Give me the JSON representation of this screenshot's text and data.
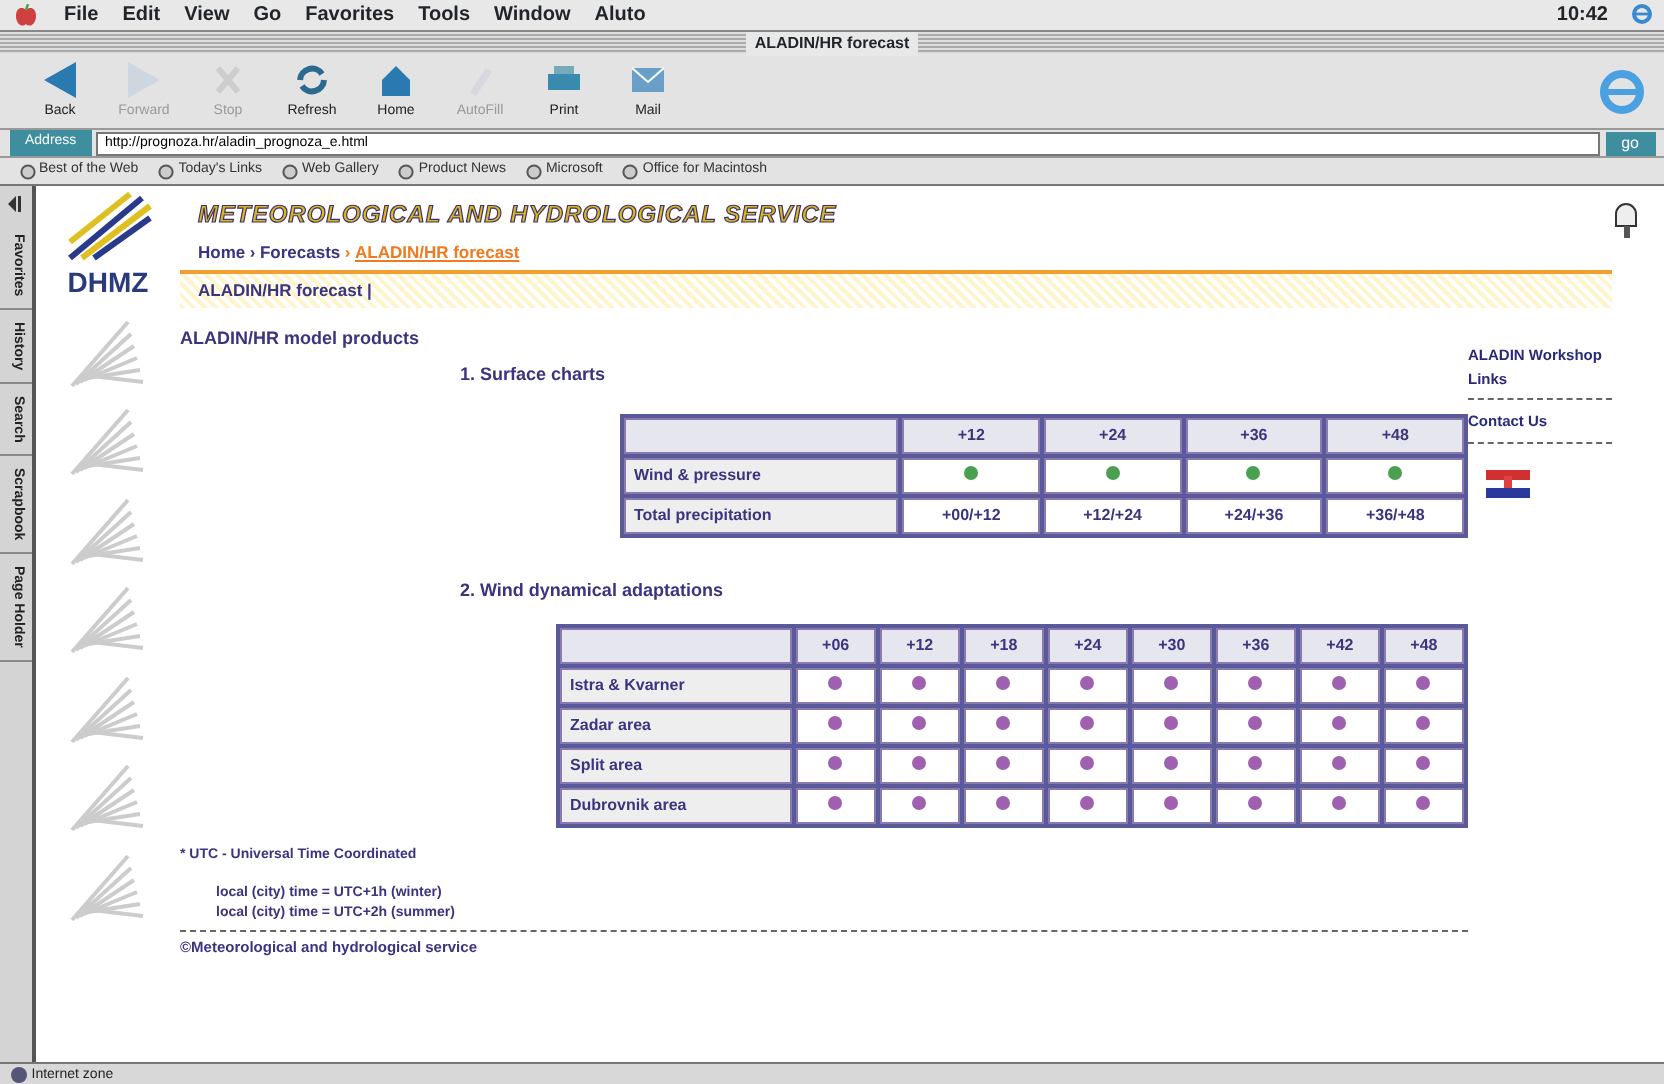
{
  "menu_bar": {
    "items": [
      "File",
      "Edit",
      "View",
      "Go",
      "Favorites",
      "Tools",
      "Window",
      "Aluto"
    ],
    "clock": "10:42"
  },
  "window": {
    "title": "ALADIN/HR forecast"
  },
  "toolbar": [
    {
      "label": "Back",
      "disabled": false,
      "kind": "back"
    },
    {
      "label": "Forward",
      "disabled": true,
      "kind": "forward"
    },
    {
      "label": "Stop",
      "disabled": true,
      "kind": "stop"
    },
    {
      "label": "Refresh",
      "disabled": false,
      "kind": "refresh"
    },
    {
      "label": "Home",
      "disabled": false,
      "kind": "home"
    },
    {
      "label": "AutoFill",
      "disabled": true,
      "kind": "autofill"
    },
    {
      "label": "Print",
      "disabled": false,
      "kind": "print"
    },
    {
      "label": "Mail",
      "disabled": false,
      "kind": "mail"
    }
  ],
  "address_bar": {
    "label": "Address",
    "value": "http://prognoza.hr/aladin_prognoza_e.html",
    "go": "go"
  },
  "favorites_bar": [
    "Best of the Web",
    "Today's Links",
    "Web Gallery",
    "Product News",
    "Microsoft",
    "Office for Macintosh"
  ],
  "explorer_tabs": [
    "Favorites",
    "History",
    "Search",
    "Scrapbook",
    "Page Holder"
  ],
  "page": {
    "logo_text": "DHMZ",
    "site_title": "METEOROLOGICAL AND HYDROLOGICAL SERVICE",
    "breadcrumb": [
      {
        "label": "Home",
        "current": false
      },
      {
        "label": "Forecasts",
        "current": false
      },
      {
        "label": "ALADIN/HR forecast",
        "current": true
      }
    ],
    "breadcrumb_separator": "›",
    "section_title": "ALADIN/HR forecast |",
    "heading": "ALADIN/HR model products",
    "surface_charts": {
      "title": "1. Surface charts",
      "columns": [
        "+12",
        "+24",
        "+36",
        "+48"
      ],
      "rows": [
        {
          "label": "Wind & pressure",
          "kind": "dots",
          "cells": [
            "",
            "",
            "",
            ""
          ]
        },
        {
          "label": "Total precipitation",
          "kind": "text",
          "cells": [
            "+00/+12",
            "+12/+24",
            "+24/+36",
            "+36/+48"
          ]
        }
      ]
    },
    "wind_adaptations": {
      "title": "2. Wind dynamical adaptations",
      "columns": [
        "+06",
        "+12",
        "+18",
        "+24",
        "+30",
        "+36",
        "+42",
        "+48"
      ],
      "rows": [
        "Istra & Kvarner",
        "Zadar area",
        "Split area",
        "Dubrovnik area"
      ]
    },
    "notes": [
      "* UTC - Universal Time Coordinated",
      "local (city) time = UTC+1h (winter)",
      "local (city) time = UTC+2h (summer)"
    ],
    "copyright": "©Meteorological and hydrological service",
    "side_links": [
      {
        "label": "ALADIN Workshop"
      },
      {
        "label": "Links"
      },
      {
        "label": "Contact Us"
      }
    ]
  },
  "status_bar": {
    "text": "Internet zone"
  }
}
